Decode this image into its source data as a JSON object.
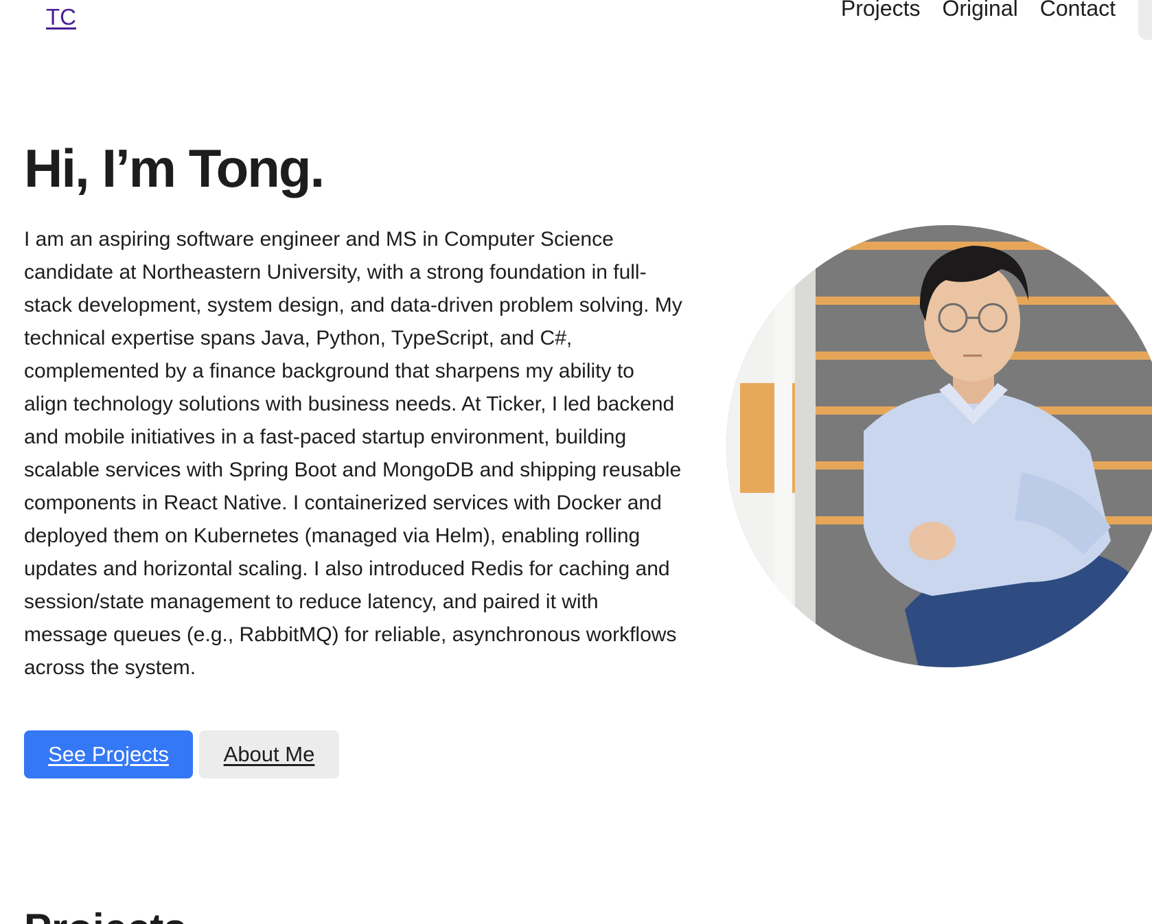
{
  "header": {
    "logo": "TC",
    "nav": [
      "Projects",
      "Original",
      "Contact"
    ]
  },
  "hero": {
    "title": "Hi, I’m Tong.",
    "paragraph": "I am an aspiring software engineer and MS in Computer Science candidate at Northeastern University, with a strong foundation in full-stack development, system design, and data-driven problem solving. My technical expertise spans Java, Python, TypeScript, and C#, complemented by a finance background that sharpens my ability to align technology solutions with business needs. At Ticker, I led backend and mobile initiatives in a fast-paced startup environment, building scalable services with Spring Boot and MongoDB and shipping reusable components in React Native. I containerized services with Docker and deployed them on Kubernetes (managed via Helm), enabling rolling updates and horizontal scaling. I also introduced Redis for caching and session/state management to reduce latency, and paired it with message queues (e.g., RabbitMQ) for reliable, asynchronous workflows across the system.",
    "primary_button": "See Projects",
    "secondary_button": "About Me"
  },
  "next_section": {
    "title": "Projects"
  },
  "colors": {
    "primary": "#3478f6",
    "secondary_button_bg": "#ececec",
    "logo_link": "#4a1d96",
    "text": "#1d1d1f"
  }
}
